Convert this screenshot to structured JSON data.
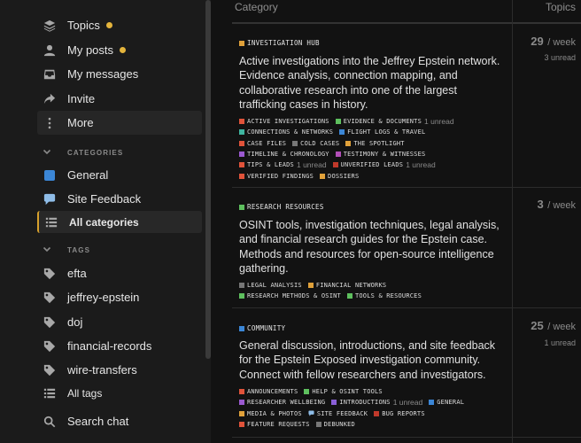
{
  "sidebar": {
    "nav": [
      {
        "label": "Topics",
        "icon": "layers-icon",
        "dot": true
      },
      {
        "label": "My posts",
        "icon": "user-icon",
        "dot": true
      },
      {
        "label": "My messages",
        "icon": "inbox-icon",
        "dot": false
      },
      {
        "label": "Invite",
        "icon": "share-icon",
        "dot": false
      },
      {
        "label": "More",
        "icon": "more-vertical-icon",
        "dot": false
      }
    ],
    "categories_heading": "CATEGORIES",
    "categories": [
      {
        "label": "General",
        "color": "#3b86d6"
      },
      {
        "label": "Site Feedback",
        "color": "#8fbde8"
      },
      {
        "label": "All categories"
      }
    ],
    "tags_heading": "TAGS",
    "tags": [
      "efta",
      "jeffrey-epstein",
      "doj",
      "financial-records",
      "wire-transfers"
    ],
    "all_tags": "All tags",
    "search_chat": "Search chat"
  },
  "table": {
    "col_category": "Category",
    "col_topics": "Topics",
    "rows": [
      {
        "name": "INVESTIGATION HUB",
        "color": "#e0a13a",
        "description": "Active investigations into the Jeffrey Epstein network. Evidence analysis, connection mapping, and collaborative research into one of the largest trafficking cases in history.",
        "count": "29",
        "per": "/ week",
        "unread": "3 unread",
        "subs": [
          [
            {
              "n": "ACTIVE INVESTIGATIONS",
              "c": "#e0533a"
            },
            {
              "n": "EVIDENCE & DOCUMENTS",
              "c": "#5ec05e",
              "u": "1 unread"
            }
          ],
          [
            {
              "n": "CONNECTIONS & NETWORKS",
              "c": "#3fb5a0"
            },
            {
              "n": "FLIGHT LOGS & TRAVEL",
              "c": "#3b86d6"
            }
          ],
          [
            {
              "n": "CASE FILES",
              "c": "#e0533a"
            },
            {
              "n": "COLD CASES",
              "c": "#777777"
            },
            {
              "n": "THE SPOTLIGHT",
              "c": "#e0a13a"
            }
          ],
          [
            {
              "n": "TIMELINE & CHRONOLOGY",
              "c": "#9b59d0"
            },
            {
              "n": "TESTIMONY & WITNESSES",
              "c": "#b24fb8"
            }
          ],
          [
            {
              "n": "TIPS & LEADS",
              "c": "#e0533a",
              "u": "1 unread"
            },
            {
              "n": "UNVERIFIED LEADS",
              "c": "#c0392b",
              "u": "1 unread"
            }
          ],
          [
            {
              "n": "VERIFIED FINDINGS",
              "c": "#e0533a"
            },
            {
              "n": "DOSSIERS",
              "c": "#e0a13a"
            }
          ]
        ]
      },
      {
        "name": "RESEARCH RESOURCES",
        "color": "#5ec05e",
        "description": "OSINT tools, investigation techniques, legal analysis, and financial research guides for the Epstein case. Methods and resources for open-source intelligence gathering.",
        "count": "3",
        "per": "/ week",
        "unread": "",
        "subs": [
          [
            {
              "n": "LEGAL ANALYSIS",
              "c": "#777777"
            },
            {
              "n": "FINANCIAL NETWORKS",
              "c": "#e0a13a"
            }
          ],
          [
            {
              "n": "RESEARCH METHODS & OSINT",
              "c": "#5ec05e"
            },
            {
              "n": "TOOLS & RESOURCES",
              "c": "#5ec05e"
            }
          ]
        ]
      },
      {
        "name": "COMMUNITY",
        "color": "#3b86d6",
        "description": "General discussion, introductions, and site feedback for the Epstein Exposed investigation community. Connect with fellow researchers and investigators.",
        "count": "25",
        "per": "/ week",
        "unread": "1 unread",
        "subs": [
          [
            {
              "n": "ANNOUNCEMENTS",
              "c": "#e0533a"
            },
            {
              "n": "HELP & OSINT TOOLS",
              "c": "#5ec05e"
            }
          ],
          [
            {
              "n": "RESEARCHER WELLBEING",
              "c": "#9b59d0"
            },
            {
              "n": "INTRODUCTIONS",
              "c": "#8a5fd6",
              "u": "1 unread"
            },
            {
              "n": "GENERAL",
              "c": "#3b86d6"
            }
          ],
          [
            {
              "n": "MEDIA & PHOTOS",
              "c": "#e0a13a"
            },
            {
              "n": "SITE FEEDBACK",
              "c": "#8fbde8",
              "icon": "speech-bubble-icon"
            },
            {
              "n": "BUG REPORTS",
              "c": "#c0392b"
            }
          ],
          [
            {
              "n": "FEATURE REQUESTS",
              "c": "#e0533a"
            },
            {
              "n": "DEBUNKED",
              "c": "#777777"
            }
          ]
        ]
      }
    ]
  }
}
